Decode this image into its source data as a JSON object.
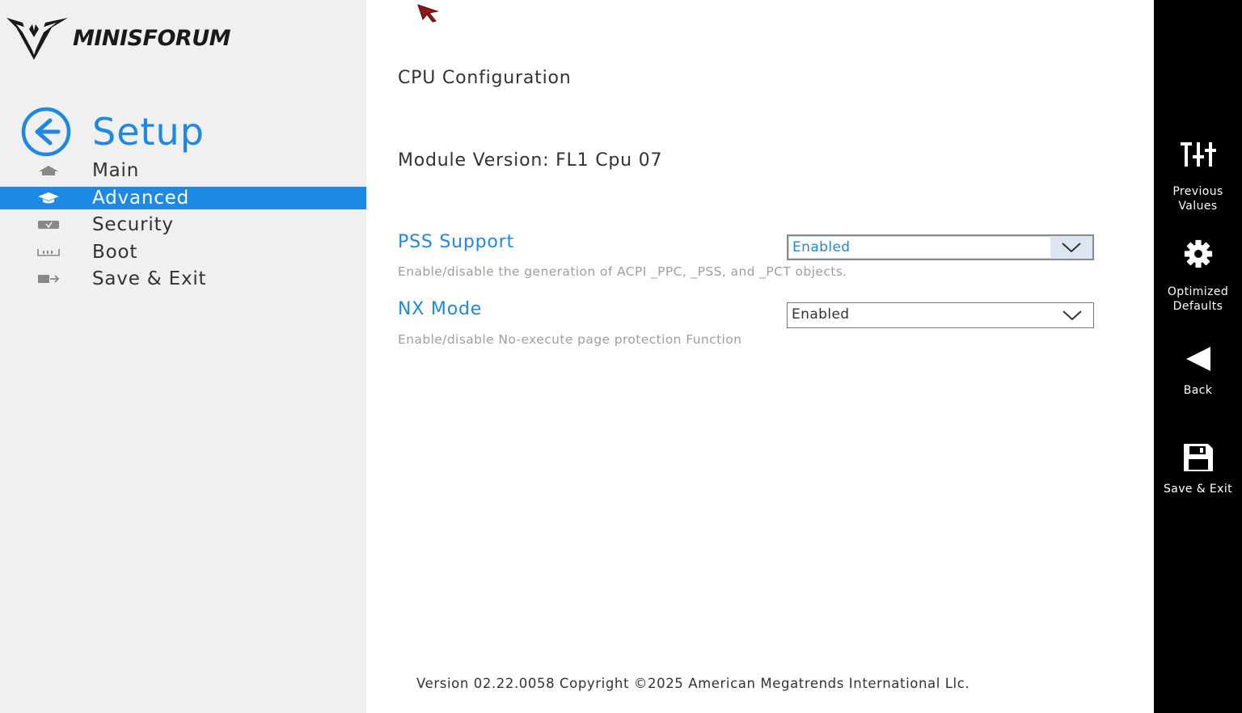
{
  "brand": {
    "name": "MINISFORUM"
  },
  "sidebar": {
    "title": "Setup",
    "items": [
      {
        "label": "Main",
        "icon": "home-icon",
        "active": false
      },
      {
        "label": "Advanced",
        "icon": "graduation-cap-icon",
        "active": true
      },
      {
        "label": "Security",
        "icon": "shield-icon",
        "active": false
      },
      {
        "label": "Boot",
        "icon": "boot-icon",
        "active": false
      },
      {
        "label": "Save & Exit",
        "icon": "exit-icon",
        "active": false
      }
    ]
  },
  "main": {
    "title": "CPU Configuration",
    "module_version": "Module Version: FL1 Cpu 07",
    "settings": [
      {
        "label": "PSS Support",
        "value": "Enabled",
        "description": "Enable/disable the generation of ACPI _PPC, _PSS, and _PCT objects.",
        "focused": true
      },
      {
        "label": "NX Mode",
        "value": "Enabled",
        "description": "Enable/disable No-execute page protection Function",
        "focused": false
      }
    ],
    "footer": "Version 02.22.0058 Copyright ©2025 American Megatrends International Llc."
  },
  "toolbar": {
    "items": [
      {
        "label_line1": "Previous",
        "label_line2": "Values",
        "icon": "sliders-icon"
      },
      {
        "label_line1": "Optimized",
        "label_line2": "Defaults",
        "icon": "gear-icon"
      },
      {
        "label_line1": "Back",
        "label_line2": "",
        "icon": "back-triangle-icon"
      },
      {
        "label_line1": "Save & Exit",
        "label_line2": "",
        "icon": "floppy-disk-icon"
      }
    ]
  },
  "colors": {
    "accent": "#1e88e5",
    "sidebar_bg": "#f0f0f0",
    "toolbar_bg": "#000000",
    "description": "#9e9e9e"
  }
}
